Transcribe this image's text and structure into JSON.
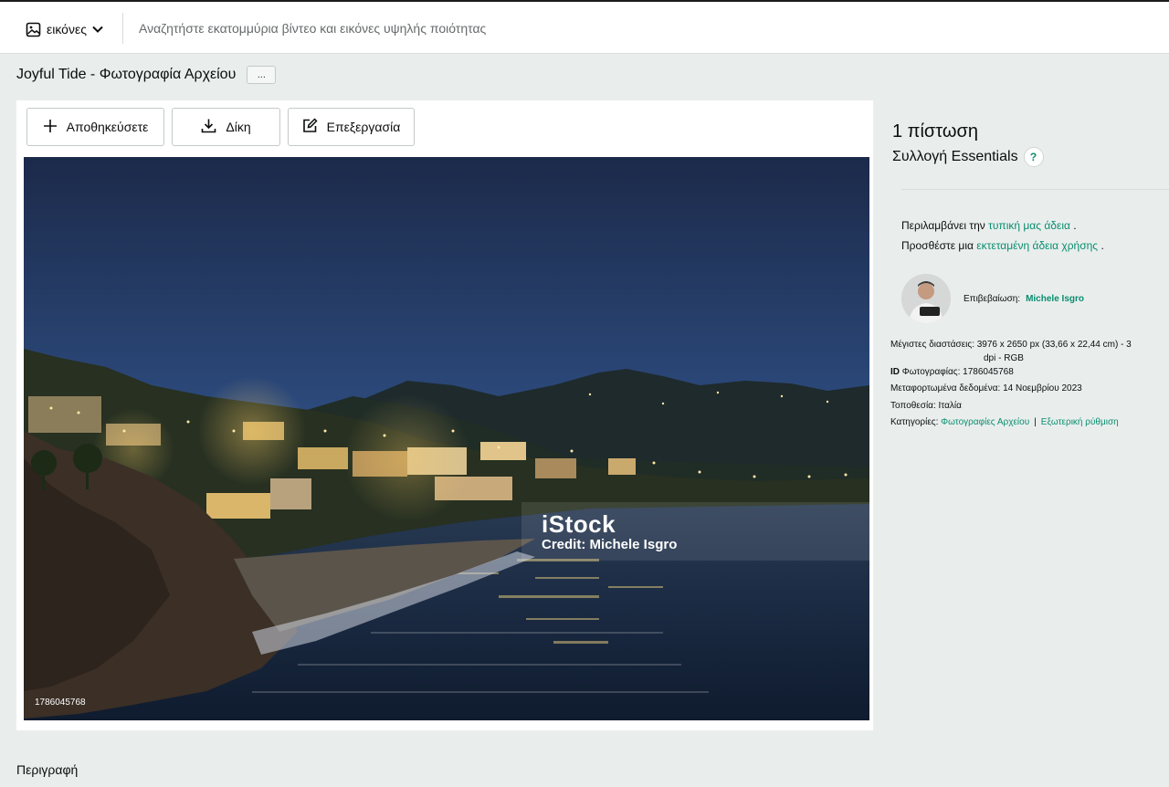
{
  "search": {
    "media_type": "εικόνες",
    "placeholder": "Αναζητήστε εκατομμύρια βίντεο και εικόνες υψηλής ποιότητας",
    "value": ""
  },
  "page": {
    "title": "Joyful Tide - Φωτογραφία Αρχείου",
    "more_label": "..."
  },
  "toolbar": {
    "save_label": "Αποθηκεύσετε",
    "try_label": "Δίκη",
    "edit_label": "Επεξεργασία"
  },
  "photo": {
    "watermark_logo": "iStock",
    "watermark_credit": "Credit: Michele Isgro",
    "id_overlay": "1786045768"
  },
  "pricing": {
    "credits": "1 πίστωση",
    "collection": "Συλλογή Essentials",
    "help": "?"
  },
  "license": {
    "line1_prefix": "Περιλαμβάνει την",
    "line1_link": "τυπική μας άδεια",
    "line1_suffix": ".",
    "line2_prefix": "Προσθέστε μια",
    "line2_link": "εκτεταμένη άδεια χρήσης",
    "line2_suffix": "."
  },
  "contributor": {
    "label": "Επιβεβαίωση:",
    "name": "Michele Isgro"
  },
  "details": {
    "dimensions_label": "Μέγιστες διαστάσεις:",
    "dimensions_value": "3976 x 2650 px (33,66 x 22,44 cm) - 3",
    "dimensions_cont": "dpi - RGB",
    "id_label_bold": "ID",
    "id_label": "Φωτογραφίας:",
    "id_value": "1786045768",
    "uploaded_label": "Μεταφορτωμένα δεδομένα:",
    "uploaded_value": "14 Νοεμβρίου 2023",
    "location_label": "Τοποθεσία:",
    "location_value": "Ιταλία",
    "categories_label": "Κατηγορίες:",
    "category1": "Φωτογραφίες Αρχείου",
    "category_sep": "|",
    "category2": "Εξωτερική ρύθμιση"
  },
  "description": {
    "heading": "Περιγραφή"
  },
  "colors": {
    "accent": "#0a8d6e",
    "background": "#e9eeed",
    "text": "#0c0d0d"
  },
  "icons": {
    "media": "image-icon",
    "dropdown": "chevron-down-icon",
    "save": "plus-icon",
    "try": "download-icon",
    "edit": "edit-icon"
  }
}
